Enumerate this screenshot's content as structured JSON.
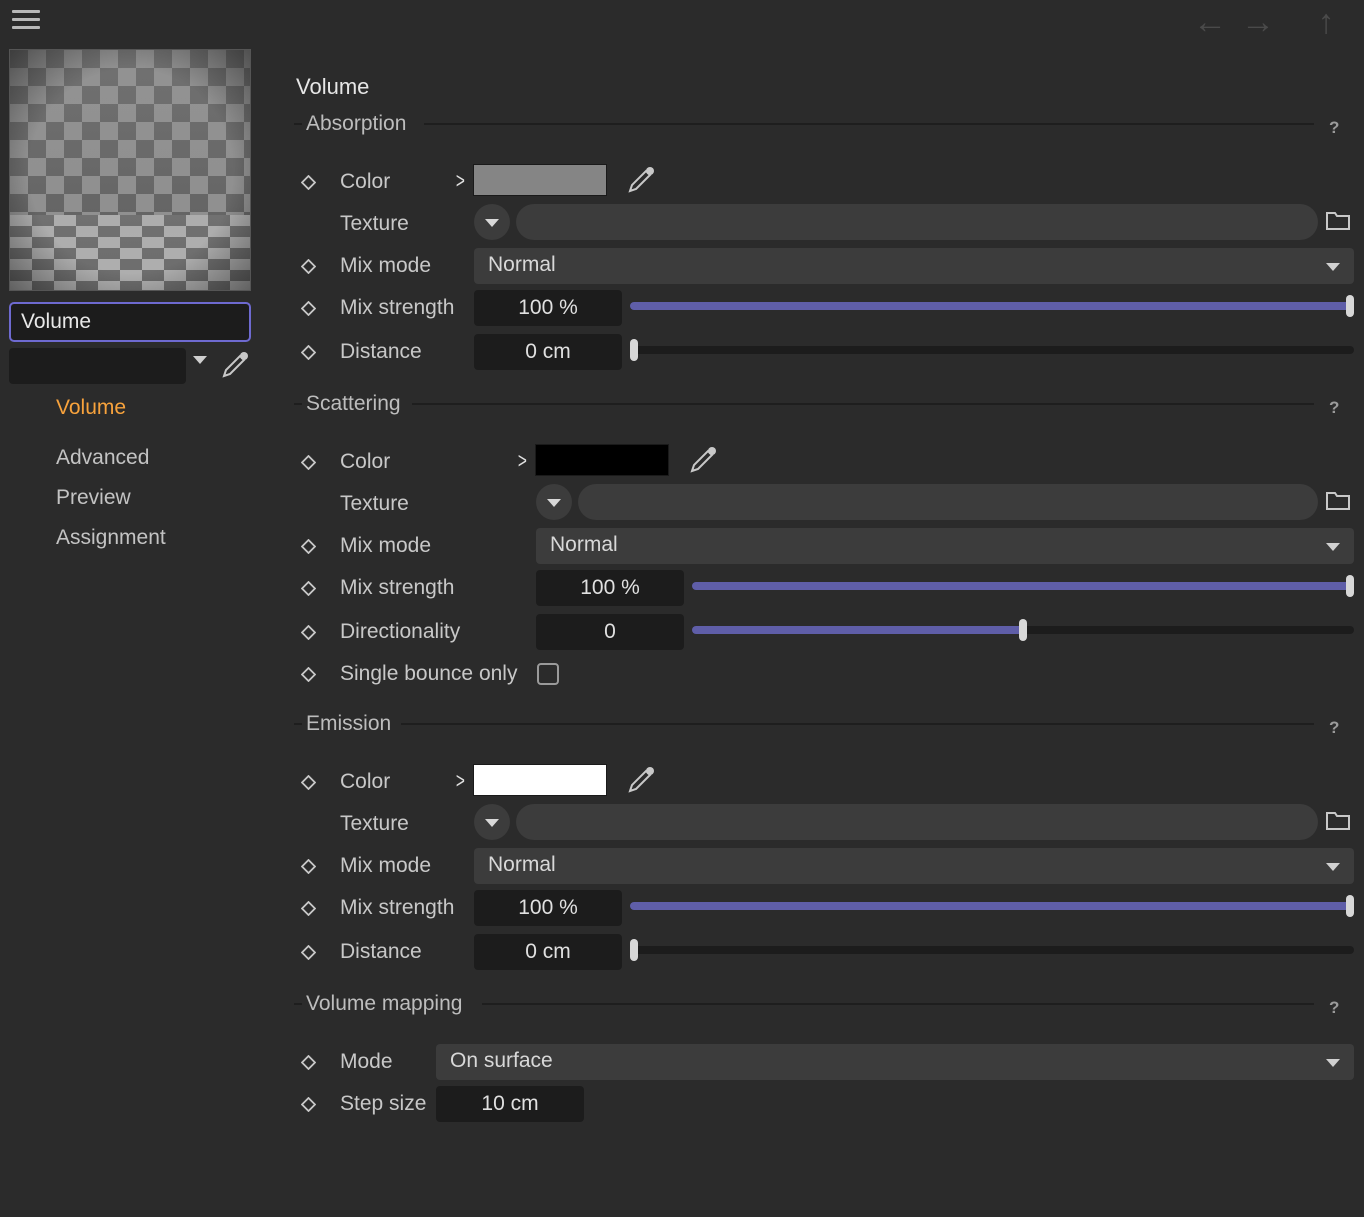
{
  "toolbar": {
    "menu_icon": "hamburger-icon",
    "back_glyph": "←",
    "forward_glyph": "→",
    "up_glyph": "↑"
  },
  "sidebar": {
    "name": "Volume",
    "preset_value": "",
    "items": [
      {
        "label": "Volume",
        "active": true
      },
      {
        "label": "Advanced",
        "active": false
      },
      {
        "label": "Preview",
        "active": false
      },
      {
        "label": "Assignment",
        "active": false
      }
    ]
  },
  "page_title": "Volume",
  "help_glyph": "?",
  "absorption": {
    "title": "Absorption",
    "color_label": "Color",
    "color_value": "#858585",
    "texture_label": "Texture",
    "mix_mode_label": "Mix mode",
    "mix_mode_value": "Normal",
    "mix_strength_label": "Mix strength",
    "mix_strength_value": "100 %",
    "mix_strength_fraction": 1.0,
    "distance_label": "Distance",
    "distance_value": "0 cm",
    "distance_fraction": 0.0
  },
  "scattering": {
    "title": "Scattering",
    "color_label": "Color",
    "color_value": "#000000",
    "texture_label": "Texture",
    "mix_mode_label": "Mix mode",
    "mix_mode_value": "Normal",
    "mix_strength_label": "Mix strength",
    "mix_strength_value": "100 %",
    "mix_strength_fraction": 1.0,
    "directionality_label": "Directionality",
    "directionality_value": "0",
    "directionality_fraction": 0.5,
    "single_bounce_label": "Single bounce only",
    "single_bounce_checked": false
  },
  "emission": {
    "title": "Emission",
    "color_label": "Color",
    "color_value": "#ffffff",
    "texture_label": "Texture",
    "mix_mode_label": "Mix mode",
    "mix_mode_value": "Normal",
    "mix_strength_label": "Mix strength",
    "mix_strength_value": "100 %",
    "mix_strength_fraction": 1.0,
    "distance_label": "Distance",
    "distance_value": "0 cm",
    "distance_fraction": 0.0
  },
  "volume_mapping": {
    "title": "Volume mapping",
    "mode_label": "Mode",
    "mode_value": "On surface",
    "step_size_label": "Step size",
    "step_size_value": "10 cm"
  },
  "colors": {
    "accent": "#f7a23c",
    "slider_fill": "#5f5ea8",
    "focus_border": "#6e6ad0",
    "background": "#2b2b2b"
  }
}
